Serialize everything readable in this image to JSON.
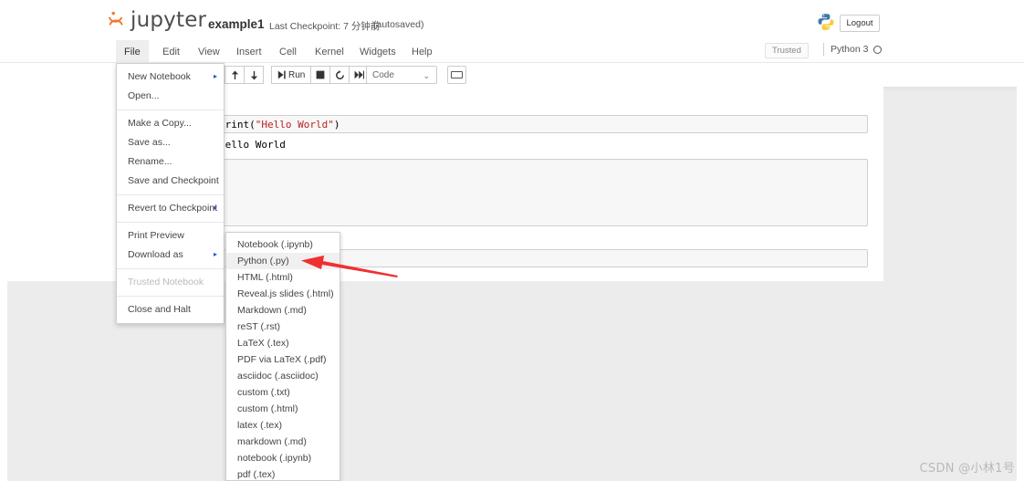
{
  "header": {
    "logo_word": "jupyter",
    "logo_icon": "jupyter-logo-icon",
    "notebook_name": "example1",
    "checkpoint_text": "Last Checkpoint: 7 分钟前",
    "autosaved_text": "(autosaved)",
    "python_logo_icon": "python-logo-icon",
    "logout_label": "Logout"
  },
  "menubar": {
    "items": [
      {
        "label": "File",
        "active": true
      },
      {
        "label": "Edit",
        "active": false
      },
      {
        "label": "View",
        "active": false
      },
      {
        "label": "Insert",
        "active": false
      },
      {
        "label": "Cell",
        "active": false
      },
      {
        "label": "Kernel",
        "active": false
      },
      {
        "label": "Widgets",
        "active": false
      },
      {
        "label": "Help",
        "active": false
      }
    ],
    "trusted_label": "Trusted",
    "kernel_label": "Python 3",
    "kernel_status_icon": "kernel-idle-circle-icon"
  },
  "toolbar": {
    "save_icon": "save-disk-icon",
    "add_icon": "plus-icon",
    "cut_icon": "scissors-icon",
    "copy_icon": "copy-icon",
    "paste_icon": "paste-icon",
    "up_icon": "arrow-up-icon",
    "down_icon": "arrow-down-icon",
    "run_label": "Run",
    "run_icon": "run-play-icon",
    "stop_icon": "stop-square-icon",
    "restart_icon": "restart-circular-icon",
    "restart_run_all_icon": "fast-forward-icon",
    "celltype_value": "Code",
    "celltype_chevron_icon": "chevron-down-icon",
    "command_palette_icon": "keyboard-icon"
  },
  "notebook": {
    "cell1_code_pre": "print(",
    "cell1_code_str": "\"Hello World\"",
    "cell1_code_post": ")",
    "cell1_output": "Hello World",
    "cell2_value": "",
    "cell3_value": ""
  },
  "file_menu": {
    "items": [
      {
        "label": "New Notebook",
        "submenu": true,
        "disabled": false,
        "sep_after": false
      },
      {
        "label": "Open...",
        "submenu": false,
        "disabled": false,
        "sep_after": true
      },
      {
        "label": "Make a Copy...",
        "submenu": false,
        "disabled": false,
        "sep_after": false
      },
      {
        "label": "Save as...",
        "submenu": false,
        "disabled": false,
        "sep_after": false
      },
      {
        "label": "Rename...",
        "submenu": false,
        "disabled": false,
        "sep_after": false
      },
      {
        "label": "Save and Checkpoint",
        "submenu": false,
        "disabled": false,
        "sep_after": true
      },
      {
        "label": "Revert to Checkpoint",
        "submenu": true,
        "disabled": false,
        "sep_after": true
      },
      {
        "label": "Print Preview",
        "submenu": false,
        "disabled": false,
        "sep_after": false
      },
      {
        "label": "Download as",
        "submenu": true,
        "disabled": false,
        "sep_after": true
      },
      {
        "label": "Trusted Notebook",
        "submenu": false,
        "disabled": true,
        "sep_after": true
      },
      {
        "label": "Close and Halt",
        "submenu": false,
        "disabled": false,
        "sep_after": false
      }
    ],
    "submenu_caret_glyph": "▸"
  },
  "download_submenu": {
    "items": [
      {
        "label": "Notebook (.ipynb)",
        "highlighted": false
      },
      {
        "label": "Python (.py)",
        "highlighted": true
      },
      {
        "label": "HTML (.html)",
        "highlighted": false
      },
      {
        "label": "Reveal.js slides (.html)",
        "highlighted": false
      },
      {
        "label": "Markdown (.md)",
        "highlighted": false
      },
      {
        "label": "reST (.rst)",
        "highlighted": false
      },
      {
        "label": "LaTeX (.tex)",
        "highlighted": false
      },
      {
        "label": "PDF via LaTeX (.pdf)",
        "highlighted": false
      },
      {
        "label": "asciidoc (.asciidoc)",
        "highlighted": false
      },
      {
        "label": "custom (.txt)",
        "highlighted": false
      },
      {
        "label": "custom (.html)",
        "highlighted": false
      },
      {
        "label": "latex (.tex)",
        "highlighted": false
      },
      {
        "label": "markdown (.md)",
        "highlighted": false
      },
      {
        "label": "notebook (.ipynb)",
        "highlighted": false
      },
      {
        "label": "pdf (.tex)",
        "highlighted": false
      }
    ]
  },
  "annotation": {
    "arrow_icon": "red-left-arrow-annotation-icon",
    "arrow_color": "#f03030"
  },
  "watermark": {
    "text": "CSDN @小林1号"
  },
  "colors": {
    "accent_orange": "#f37726",
    "page_background": "#ececec",
    "notebook_background": "#ffffff",
    "cell_input_background": "#f7f7f7",
    "cell_border": "#cfcfcf",
    "menu_active_background": "#eeeeee",
    "string_literal": "#bb2222",
    "annotation_red": "#f03030"
  }
}
